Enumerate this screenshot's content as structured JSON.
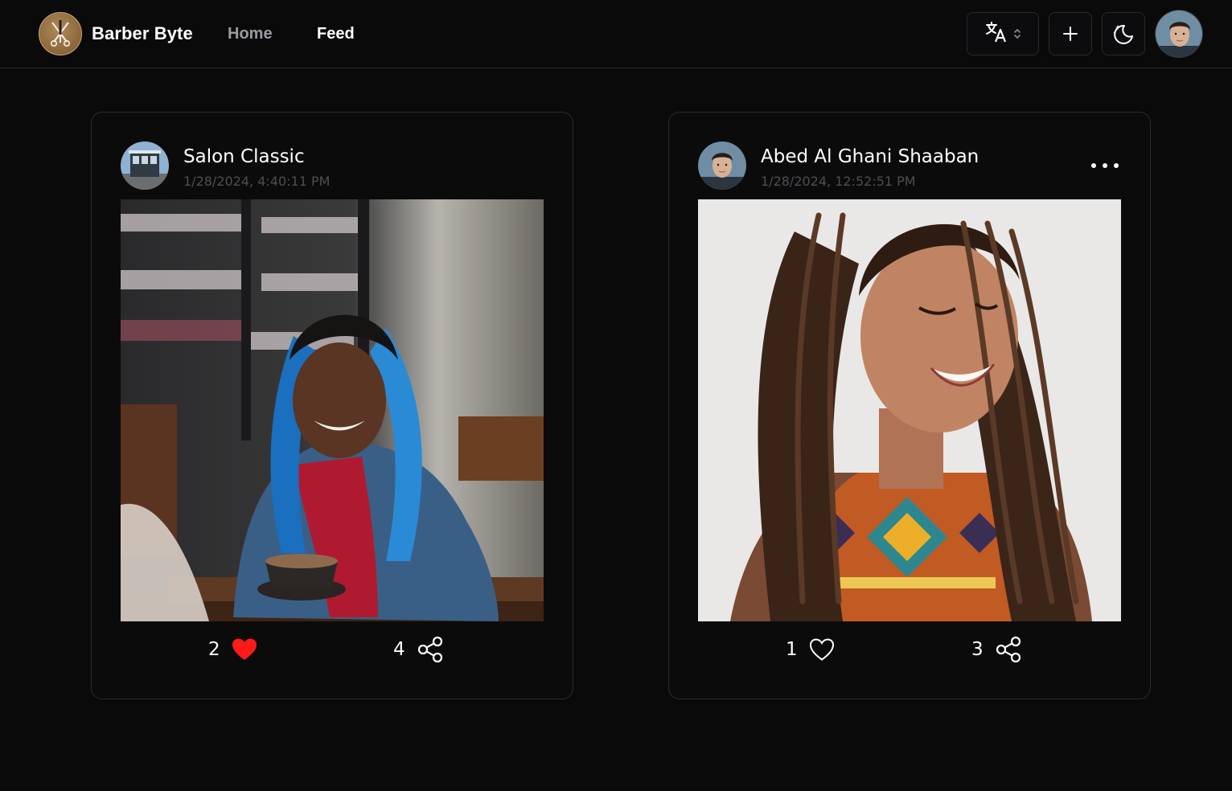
{
  "brand": {
    "name": "Barber Byte",
    "logo_icon": "scissors-razor-icon",
    "logo_color": "#8a6638"
  },
  "nav": {
    "home_label": "Home",
    "feed_label": "Feed",
    "active": "Feed"
  },
  "header_actions": {
    "language_icon": "translate-icon",
    "add_icon": "plus-icon",
    "theme_icon": "moon-stars-icon",
    "avatar": "user-avatar"
  },
  "posts": [
    {
      "author": "Salon Classic",
      "timestamp": "1/28/2024, 4:40:11 PM",
      "image": "woman-blue-braids-cafe-photo",
      "likes": "2",
      "liked": true,
      "shares": "4",
      "has_menu": false
    },
    {
      "author": "Abed Al Ghani Shaaban",
      "timestamp": "1/28/2024, 12:52:51 PM",
      "image": "woman-box-braids-portrait-photo",
      "likes": "1",
      "liked": false,
      "shares": "3",
      "has_menu": true
    }
  ],
  "colors": {
    "background": "#0a0a0b",
    "liked_heart": "#ff1a1a",
    "muted_text": "#4e4e54"
  }
}
